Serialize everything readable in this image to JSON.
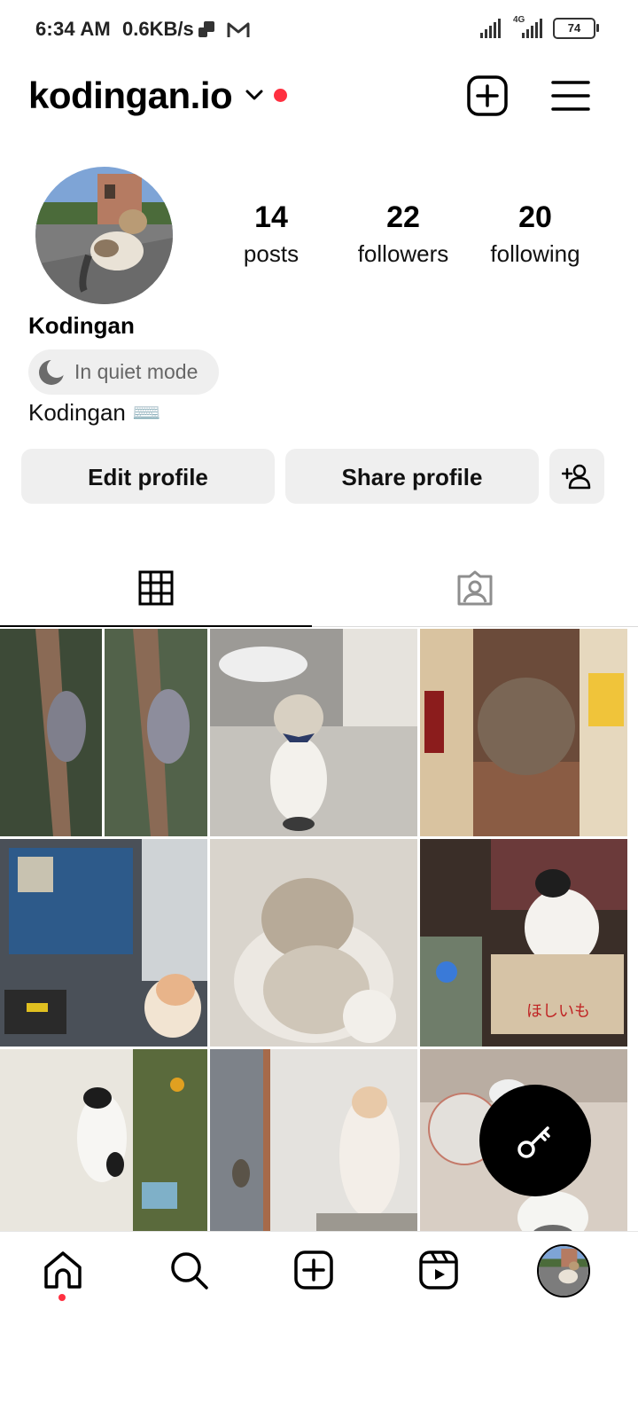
{
  "status_bar": {
    "time": "6:34 AM",
    "speed": "0.6KB/s",
    "network": "4G",
    "battery": "74"
  },
  "profile": {
    "username": "kodingan.io",
    "display_name": "Kodingan",
    "quiet_mode": "In quiet mode",
    "bio": "Kodingan ⌨️",
    "stats": {
      "posts": "14",
      "posts_label": "posts",
      "followers": "22",
      "followers_label": "followers",
      "following": "20",
      "following_label": "following"
    }
  },
  "actions": {
    "edit": "Edit profile",
    "share": "Share profile"
  },
  "colors": {
    "accent_red": "#ff3040",
    "button_bg": "#efefef"
  },
  "icons": {
    "header": [
      "new-post-icon",
      "menu-icon"
    ],
    "tabs": [
      "grid-icon",
      "tagged-icon"
    ],
    "fab": "key-icon",
    "nav": [
      "home-icon",
      "search-icon",
      "create-icon",
      "reels-icon",
      "profile-avatar"
    ]
  }
}
